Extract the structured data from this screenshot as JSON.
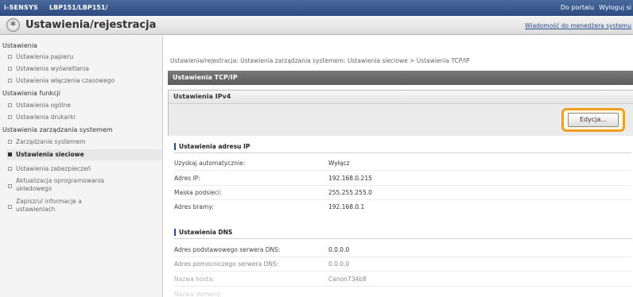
{
  "topbar": {
    "brand": "i-SENSYS",
    "model": "LBP151/LBP151/",
    "portal_link": "Do portalu",
    "logout_link": "Wyloguj si"
  },
  "titlebar": {
    "icon": "settings-icon",
    "title": "Ustawienia/rejestracja",
    "mail_link": "Wiadomość do menedżera systemu"
  },
  "sidebar": {
    "sections": [
      {
        "heading": "Ustawienia",
        "items": [
          {
            "label": "Ustawienia papieru"
          },
          {
            "label": "Ustawienia wyświetlania"
          },
          {
            "label": "Ustawienia włączenia czasowego"
          }
        ]
      },
      {
        "heading": "Ustawienia funkcji",
        "items": [
          {
            "label": "Ustawienia ogólne"
          },
          {
            "label": "Ustawienia drukarki"
          }
        ]
      },
      {
        "heading": "Ustawienia zarządzania systemem",
        "items": [
          {
            "label": "Zarządzanie systemem"
          },
          {
            "label": "Ustawienia sieciowe"
          },
          {
            "label": "Ustawienia zabezpieczeń"
          },
          {
            "label_line1": "Aktualizacja oprogramowania",
            "label_line2": "układowego"
          },
          {
            "label_line1": "Zapisz/ul informacje a",
            "label_line2": "ustawieniach"
          }
        ]
      }
    ],
    "active_item": "Ustawienia sieciowe"
  },
  "main": {
    "breadcrumb": "Ustawienia/rejestracja: Ustawienia zarządzania systemem: Ustawienia sieciowe > Ustawienia TCP/IP",
    "section_title": "Ustawienia TCP/IP",
    "ipv4_title": "Ustawienia IPv4",
    "edit_button": "Edycja...",
    "ip_group": {
      "title": "Ustawienia adresu IP",
      "rows": [
        {
          "label": "Uzyskaj automatycznie:",
          "value": "Wyłącz"
        },
        {
          "label": "Adres IP:",
          "value": "192.168.0.215"
        },
        {
          "label": "Maska podsieci:",
          "value": "255.255.255.0"
        },
        {
          "label": "Adres bramy:",
          "value": "192.168.0.1"
        }
      ]
    },
    "dns_group": {
      "title": "Ustawienia DNS",
      "rows": [
        {
          "label": "Adres podstawowego serwera DNS:",
          "value": "0.0.0.0"
        },
        {
          "label": "Adres pomocniczego serwera DNS:",
          "value": "0.0.0.0"
        },
        {
          "label": "Nazwa hosta:",
          "value": "Canon734b8"
        },
        {
          "label": "Nazwa domeny:",
          "value": ""
        }
      ]
    }
  }
}
